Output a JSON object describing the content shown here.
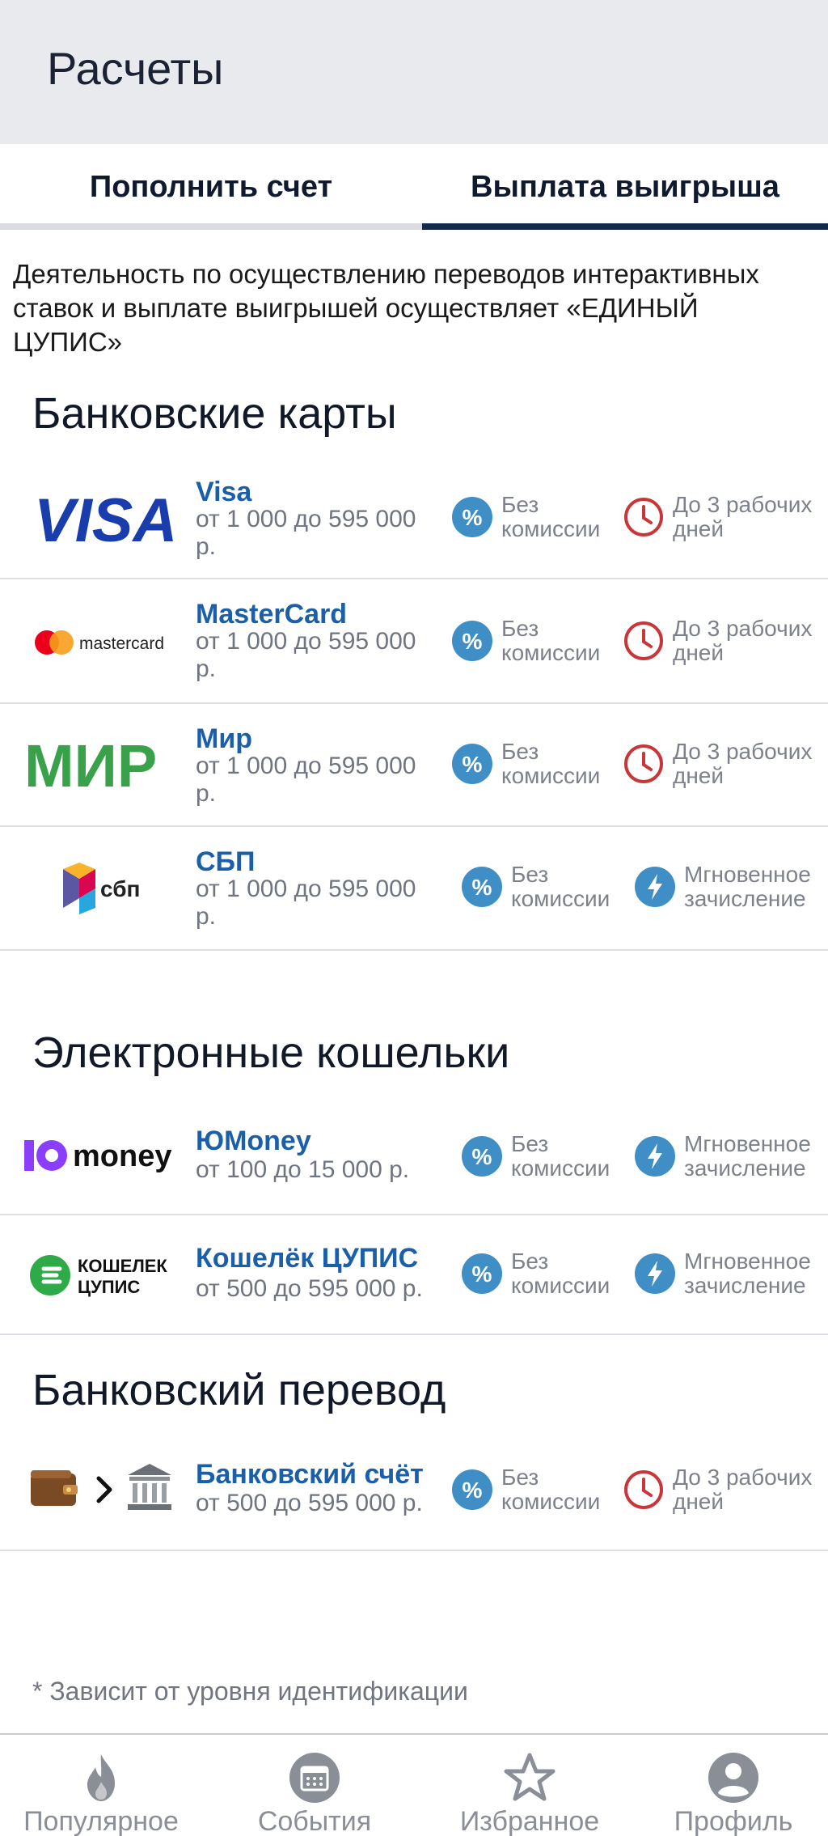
{
  "header": {
    "title": "Расчеты"
  },
  "tabs": [
    {
      "label": "Пополнить счет",
      "active": false
    },
    {
      "label": "Выплата выигрыша",
      "active": true
    }
  ],
  "notice": {
    "line1": "Деятельность по осуществлению переводов интерактивных",
    "line2": "ставок и выплате выигрышей осуществляет «ЕДИНЫЙ",
    "line3": "ЦУПИС»"
  },
  "sections": {
    "cards": {
      "title": "Банковские карты",
      "methods": [
        {
          "name": "Visa",
          "range_line1": "от 1 000 до 595 000",
          "range_line2": "р.",
          "fee_line1": "Без",
          "fee_line2": "комиссии",
          "time_line1": "До 3 рабочих",
          "time_line2": "дней",
          "logo_text": "VISA"
        },
        {
          "name": "MasterCard",
          "range_line1": "от 1 000 до 595 000",
          "range_line2": "р.",
          "fee_line1": "Без",
          "fee_line2": "комиссии",
          "time_line1": "До 3 рабочих",
          "time_line2": "дней",
          "logo_text": "mastercard"
        },
        {
          "name": "Мир",
          "range_line1": "от 1 000 до 595 000",
          "range_line2": "р.",
          "fee_line1": "Без",
          "fee_line2": "комиссии",
          "time_line1": "До 3 рабочих",
          "time_line2": "дней",
          "logo_text": "МИР"
        },
        {
          "name": "СБП",
          "range_line1": "от 1 000 до 595 000",
          "range_line2": "р.",
          "fee_line1": "Без",
          "fee_line2": "комиссии",
          "time_line1": "Мгновенное",
          "time_line2": "зачисление",
          "logo_text": "сбп"
        }
      ]
    },
    "wallets": {
      "title": "Электронные кошельки",
      "methods": [
        {
          "name": "ЮMoney",
          "range": "от 100 до 15 000 р.",
          "fee_line1": "Без",
          "fee_line2": "комиссии",
          "time_line1": "Мгновенное",
          "time_line2": "зачисление",
          "logo_text": "money"
        },
        {
          "name": "Кошелёк ЦУПИС",
          "range": "от 500 до 595 000 р.",
          "fee_line1": "Без",
          "fee_line2": "комиссии",
          "time_line1": "Мгновенное",
          "time_line2": "зачисление",
          "logo_text_1": "КОШЕЛЕК",
          "logo_text_2": "ЦУПИС"
        }
      ]
    },
    "transfer": {
      "title": "Банковский перевод",
      "methods": [
        {
          "name": "Банковский счёт",
          "range": "от 500 до 595 000 р.",
          "fee_line1": "Без",
          "fee_line2": "комиссии",
          "time_line1": "До 3 рабочих",
          "time_line2": "дней"
        }
      ]
    }
  },
  "footnote": "* Зависит от уровня идентификации",
  "bottom_nav": [
    {
      "label": "Популярное",
      "icon": "flame-icon"
    },
    {
      "label": "События",
      "icon": "calendar-icon"
    },
    {
      "label": "Избранное",
      "icon": "star-icon"
    },
    {
      "label": "Профиль",
      "icon": "user-icon"
    }
  ],
  "colors": {
    "accent_blue": "#3f8fc6",
    "clock_red": "#c9363a",
    "link_blue": "#1b5fa8",
    "tab_active": "#13294b"
  }
}
